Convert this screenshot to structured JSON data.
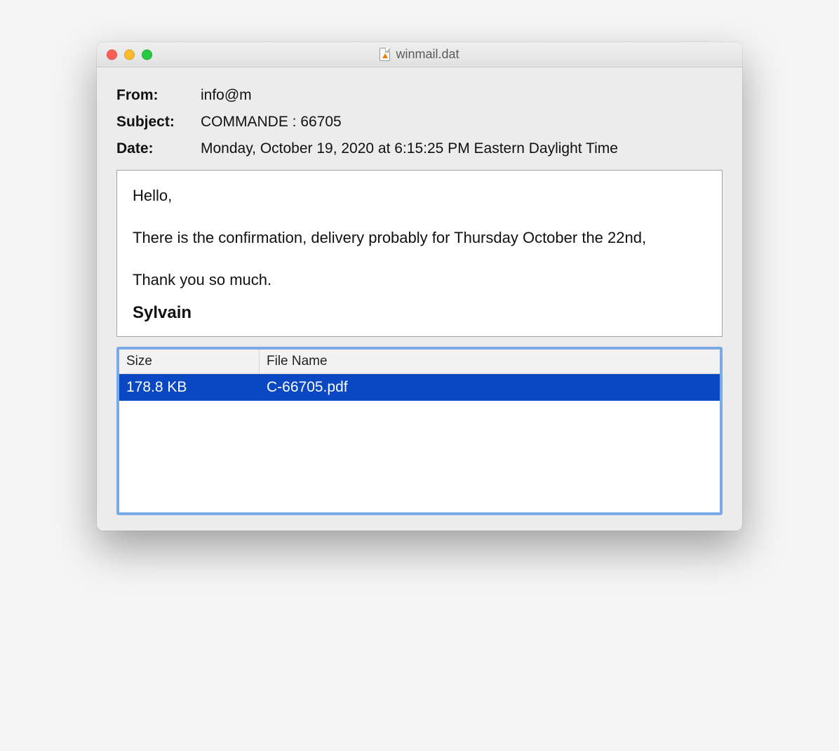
{
  "window": {
    "title": "winmail.dat"
  },
  "meta": {
    "from_label": "From:",
    "from_value": "info@m",
    "subject_label": "Subject:",
    "subject_value": "COMMANDE : 66705",
    "date_label": "Date:",
    "date_value": "Monday, October 19, 2020 at 6:15:25 PM Eastern Daylight Time"
  },
  "body": {
    "greeting": "Hello,",
    "line1": "There is the confirmation, delivery probably for Thursday October the 22nd,",
    "thanks": "Thank you so much.",
    "signature": "Sylvain"
  },
  "attachments": {
    "header_size": "Size",
    "header_name": "File Name",
    "rows": [
      {
        "size": "178.8 KB",
        "name": "C-66705.pdf",
        "selected": true
      }
    ]
  }
}
